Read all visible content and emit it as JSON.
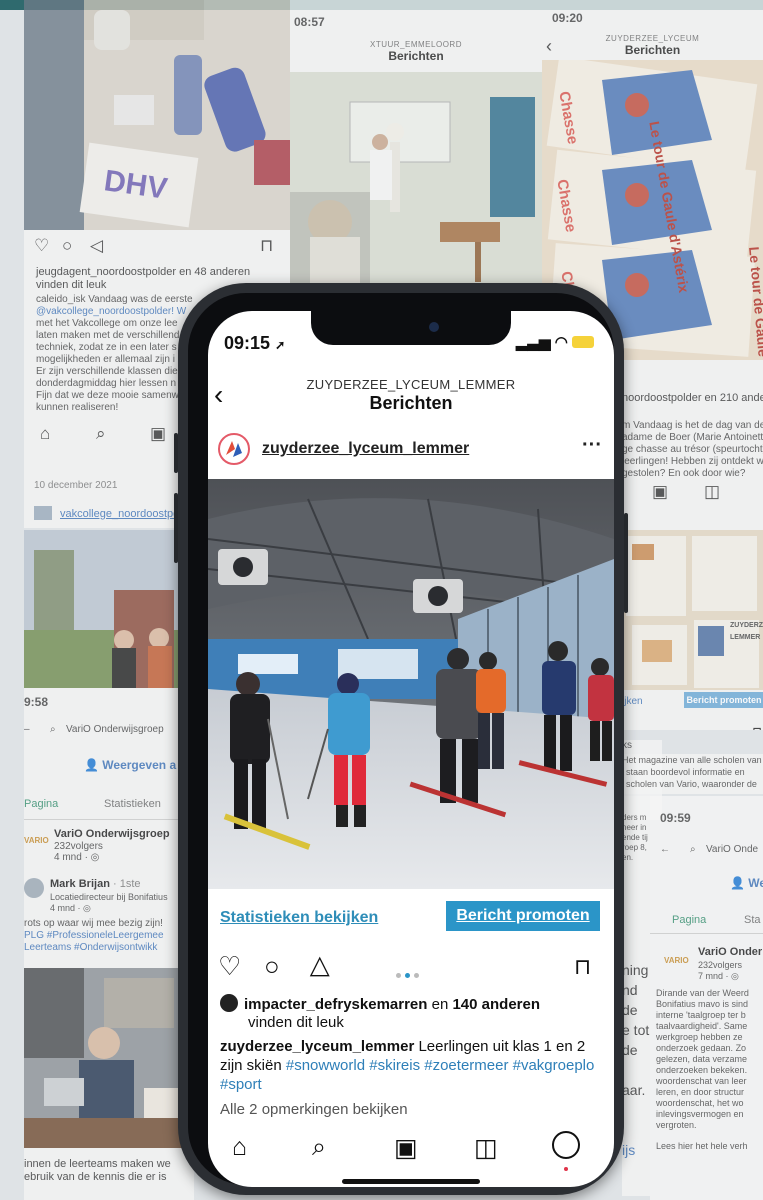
{
  "phone": {
    "status_time": "09:15",
    "status_icons": "▪▪▪ ≋ ▭",
    "header_account": "ZUYDERZEE_LYCEUM_LEMMER",
    "header_title": "Berichten",
    "back_icon": "chevron-left",
    "account_name": "zuyderzee_lyceum_lemmer",
    "more_label": "···",
    "stats_link": "Statistieken bekijken",
    "promote_button": "Bericht promoten",
    "likes_account": "impacter_defryskemarren",
    "likes_mid": " en ",
    "likes_count": "140 anderen",
    "likes_tail": "vinden dit leuk",
    "caption_user": "zuyderzee_lyceum_lemmer",
    "caption_text": " Leerlingen uit klas 1 en 2 zijn skiën ",
    "caption_tags": "#snowworld #skireis #zoetermeer #vakgroeplo #sport",
    "comments_link": "Alle 2 opmerkingen bekijken",
    "tabs": [
      "home",
      "search",
      "reels",
      "shop",
      "profile"
    ]
  },
  "bg_left_top": {
    "likes_line": "jeugdagent_noordoostpolder en 48 anderen",
    "likes_line2": "vinden dit leuk",
    "caption_lines": [
      "caleido_isk Vandaag was de eerste",
      "@vakcollege_noordoostpolder! W",
      "met het Vakcollege om onze lee",
      "laten maken met de verschillend",
      "techniek, zodat ze in een later s",
      "mogelijkheden er allemaal zijn i",
      "Er zijn verschillende klassen die",
      "donderdagmiddag hier lessen n",
      "Fijn dat we deze mooie samenw",
      "kunnen realiseren!"
    ],
    "date": "10 december 2021",
    "account": "vakcollege_noordoostpol"
  },
  "bg_mid_top": {
    "time": "08:57",
    "sub": "XTUUR_EMMELOORD",
    "title": "Berichten"
  },
  "bg_right_top": {
    "time": "09:20",
    "sub": "ZUYDERZEE_LYCEUM",
    "title": "Berichten",
    "book_title": "Le tour de Gaule d'Astérix",
    "book_side": "Chasse",
    "likes_line": "noordoostpolder en 210 anderen",
    "caption_lines": [
      "m Vandaag is het de dag van de",
      "adame de Boer (Marie Antoinette",
      "ge chasse au trésor (speurtocht)",
      "leerlingen! Hebben zij ontdekt w",
      "gestolen? En ook door wie?"
    ],
    "promote": "Bericht promoten",
    "stats_frag": "ijken",
    "magazine_lines": [
      "Het magazine van alle scholen van",
      "staan boordevol informatie en",
      "scholen van Vario, waaronder de"
    ],
    "magazine_label": "ZUYDERZEE LEMMER",
    "ks": "ks"
  },
  "bg_left_bottom": {
    "time": "9:58",
    "search": "VariO Onderwijsgroep",
    "view_button": "Weergeven a",
    "tab_page": "Pagina",
    "tab_stats": "Statistieken",
    "org_name": "VariO Onderwijsgroep",
    "org_followers": "232volgers",
    "org_time": "4 mnd · ◎",
    "person_name": "Mark Brijan",
    "person_degree": " · 1ste",
    "person_role": "Locatiedirecteur bij Bonifatius",
    "person_time": "4 mnd · ◎",
    "post_line1": "rots op waar wij mee bezig zijn!",
    "post_line2": "PLG #ProfessioneleLeergemee",
    "post_line3": "Leerteams #Onderwijsontwikk",
    "bottom_line1": "innen de leerteams maken we",
    "bottom_line2": "ebruik van de kennis die er is"
  },
  "bg_right_bottom": {
    "time": "09:59",
    "search": "VariO Onde",
    "view_button": "We",
    "tab_page": "Pagina",
    "tab_stats": "Sta",
    "org_name": "VariO Onder",
    "org_followers": "232volgers",
    "org_time": "7 mnd · ◎",
    "body_lines": [
      "Dirande van der Weerd",
      "Bonifatius mavo is sind",
      "interne 'taalgroep ter b",
      "taalvaardigheid'. Same",
      "werkgroep hebben ze",
      "onderzoek gedaan. Zo",
      "gelezen, data verzame",
      "onderzoeken bekeken.",
      "woordenschat van leer",
      "leren, en door structur",
      "woordenschat, het wo",
      "inlevingsvermogen en",
      "vergroten."
    ],
    "read_more": "Lees hier het hele verh",
    "right_frag": [
      "ders m",
      "neer in",
      "ende tij",
      "roep 8,",
      "en."
    ],
    "ning_frag": [
      "ning",
      "nd",
      "de",
      "e tot",
      "de",
      "aar.",
      "ijs"
    ]
  },
  "colors": {
    "accent": "#2b95c8",
    "link": "#2e8db8",
    "hashtag": "#2e7fb8",
    "phone_frame": "#2b2e33"
  }
}
